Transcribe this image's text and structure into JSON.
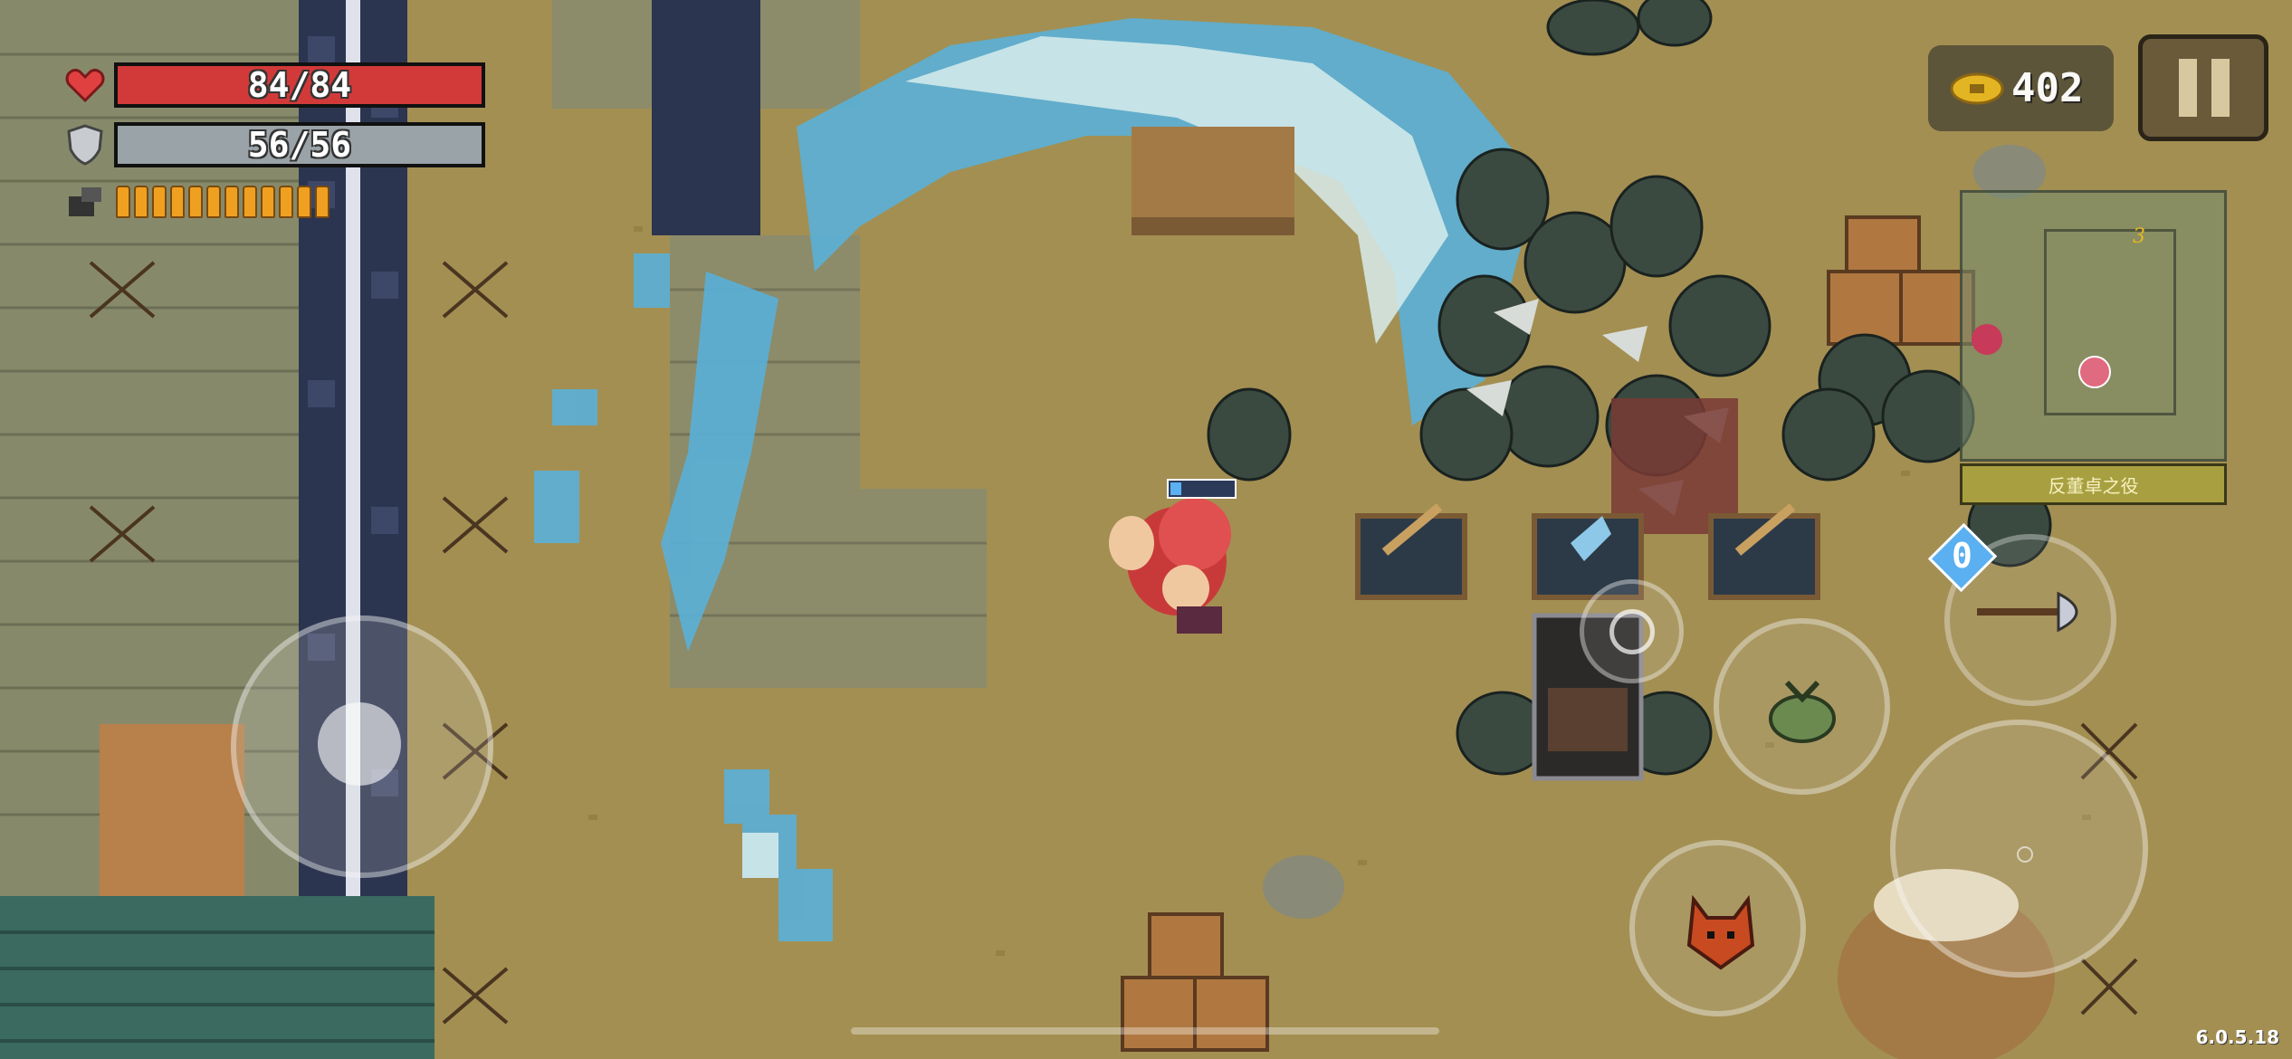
{
  "hud": {
    "health": {
      "current": 84,
      "max": 84,
      "text": "84/84",
      "color": "#d23a3a"
    },
    "armor": {
      "current": 56,
      "max": 56,
      "text": "56/56",
      "color": "#9aa3a8"
    },
    "energy": {
      "segments": 12,
      "filled": 12,
      "color": "#f0a020"
    }
  },
  "currency": {
    "icon": "gold-coin-icon",
    "value": "402"
  },
  "pause": {
    "icon": "pause-icon"
  },
  "minimap": {
    "quest_label": "反董卓之役",
    "marker_text": "3"
  },
  "skills": {
    "weapon_swap_badge": "0",
    "emote_icon": "smile-face-icon",
    "skill_icon": "green-pouch-icon",
    "pet_icon": "red-fox-icon",
    "weapon_icon": "battle-axe-icon"
  },
  "version": "6.0.5.18",
  "colors": {
    "ground": "#a38f52",
    "wall": "#8a8a6c",
    "water": "#5ab0d8",
    "enemy": "#3a4a40"
  }
}
